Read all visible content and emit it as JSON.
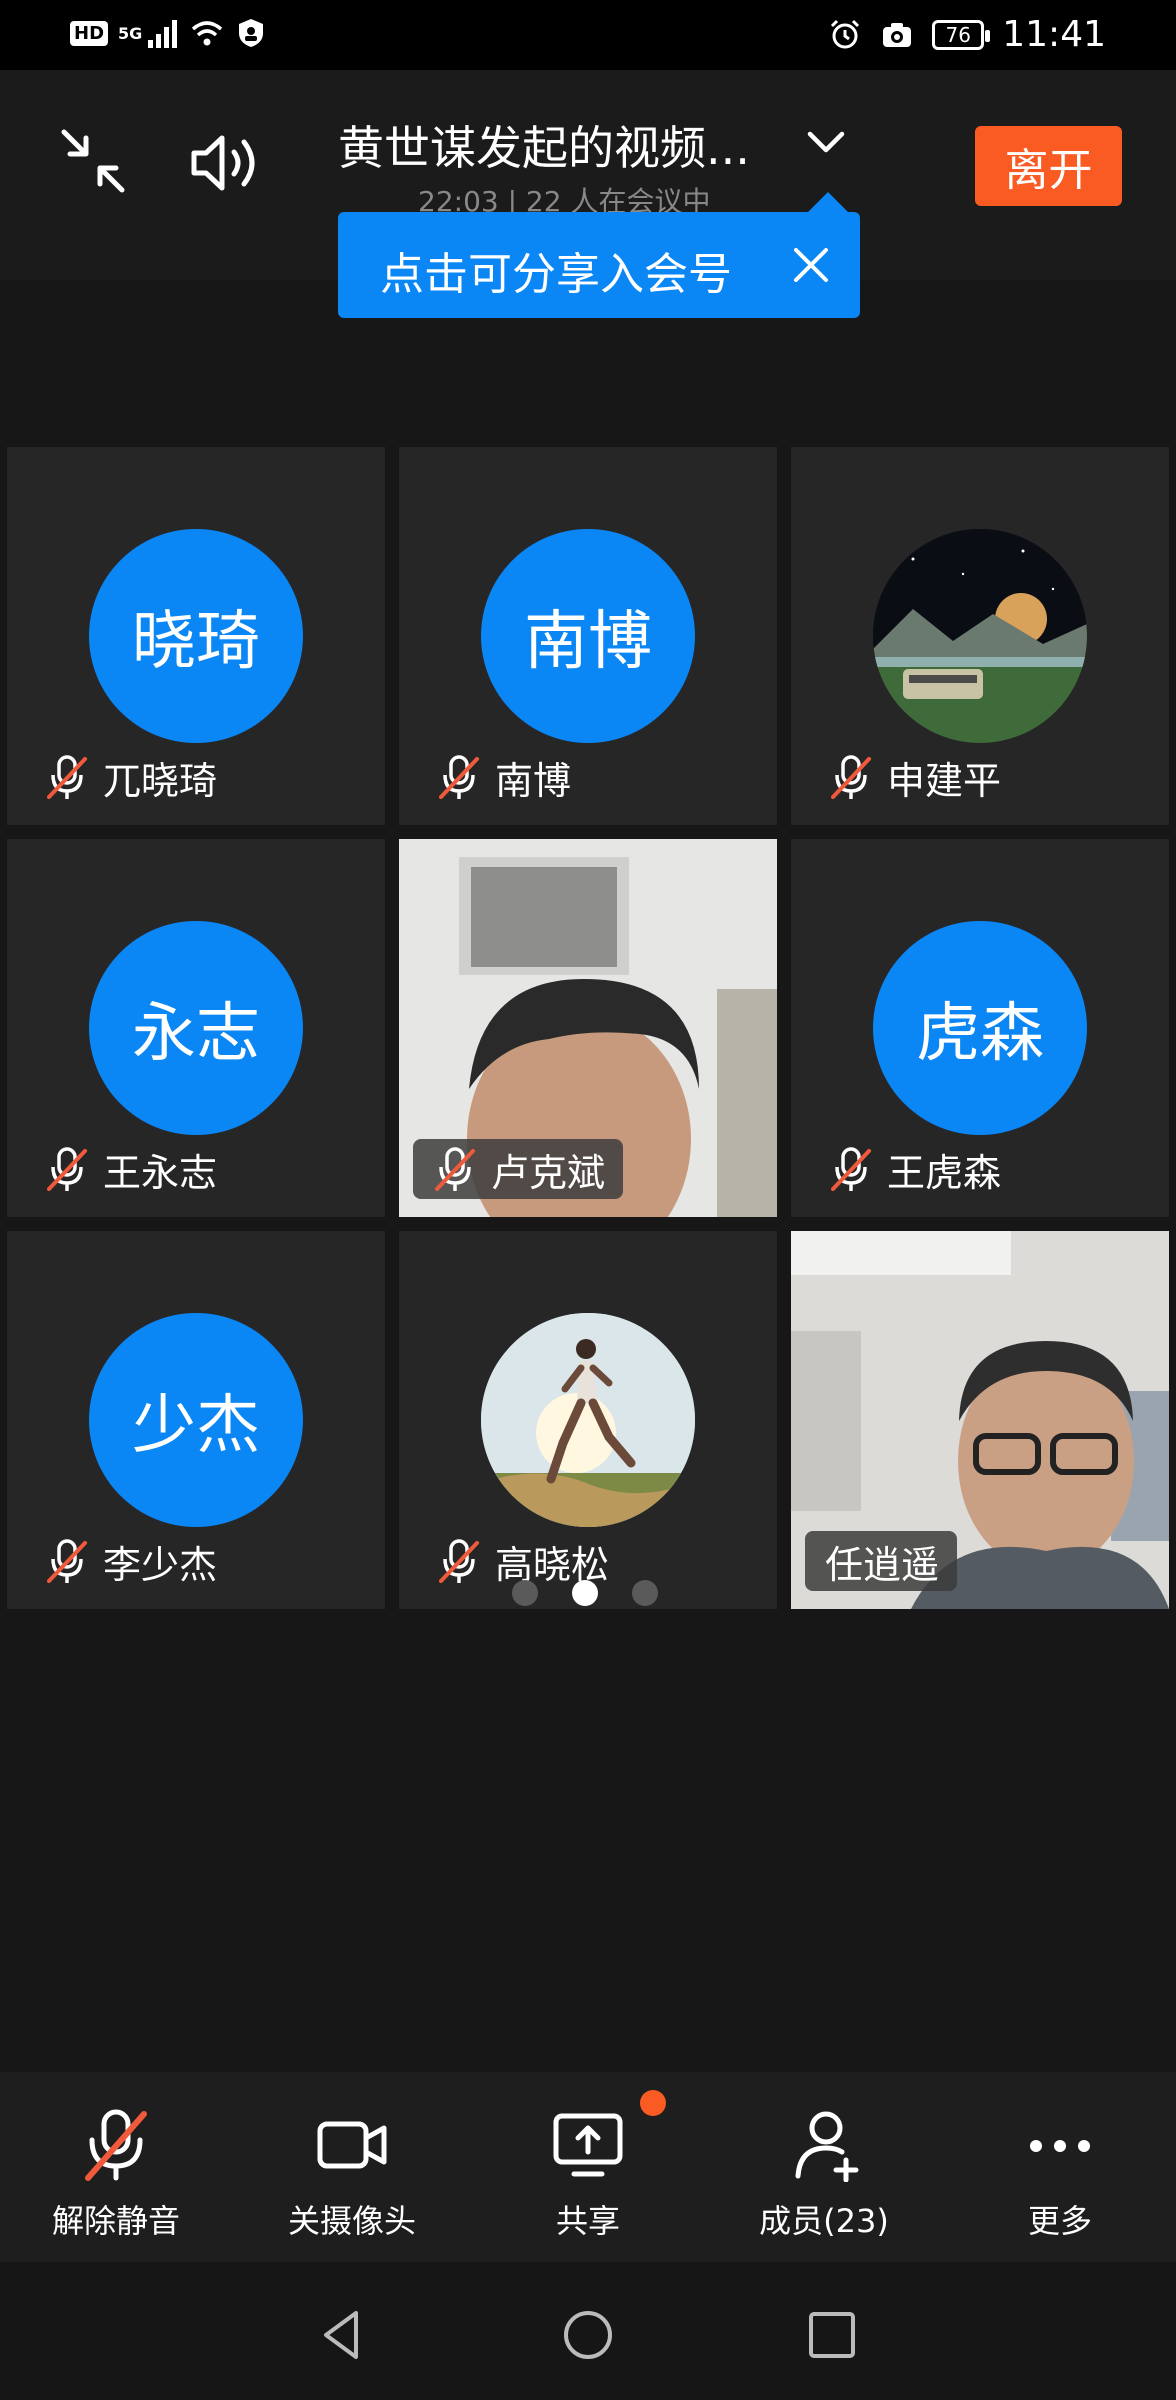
{
  "status_bar": {
    "hd_label": "HD",
    "network": "5G",
    "battery": "76",
    "time": "11:41"
  },
  "header": {
    "title": "黄世谋发起的视频...",
    "subtitle": "22:03 | 22 人在会议中",
    "leave_label": "离开"
  },
  "tooltip": {
    "text": "点击可分享入会号"
  },
  "participants": [
    {
      "initials": "晓琦",
      "name": "兀晓琦"
    },
    {
      "initials": "南博",
      "name": "南博"
    },
    {
      "initials": "",
      "name": "申建平"
    },
    {
      "initials": "永志",
      "name": "王永志"
    },
    {
      "initials": "",
      "name": "卢克斌"
    },
    {
      "initials": "虎森",
      "name": "王虎森"
    },
    {
      "initials": "少杰",
      "name": "李少杰"
    },
    {
      "initials": "",
      "name": "高晓松"
    },
    {
      "initials": "",
      "name": "任逍遥"
    }
  ],
  "pagination": {
    "pages": 3,
    "current": 2
  },
  "toolbar": {
    "unmute": "解除静音",
    "camera_off": "关摄像头",
    "share": "共享",
    "members": "成员(23)",
    "more": "更多"
  },
  "colors": {
    "accent_blue": "#0a86f5",
    "leave_orange": "#fa5b23",
    "mic_off_red": "#f05a3c",
    "background": "#171717"
  }
}
